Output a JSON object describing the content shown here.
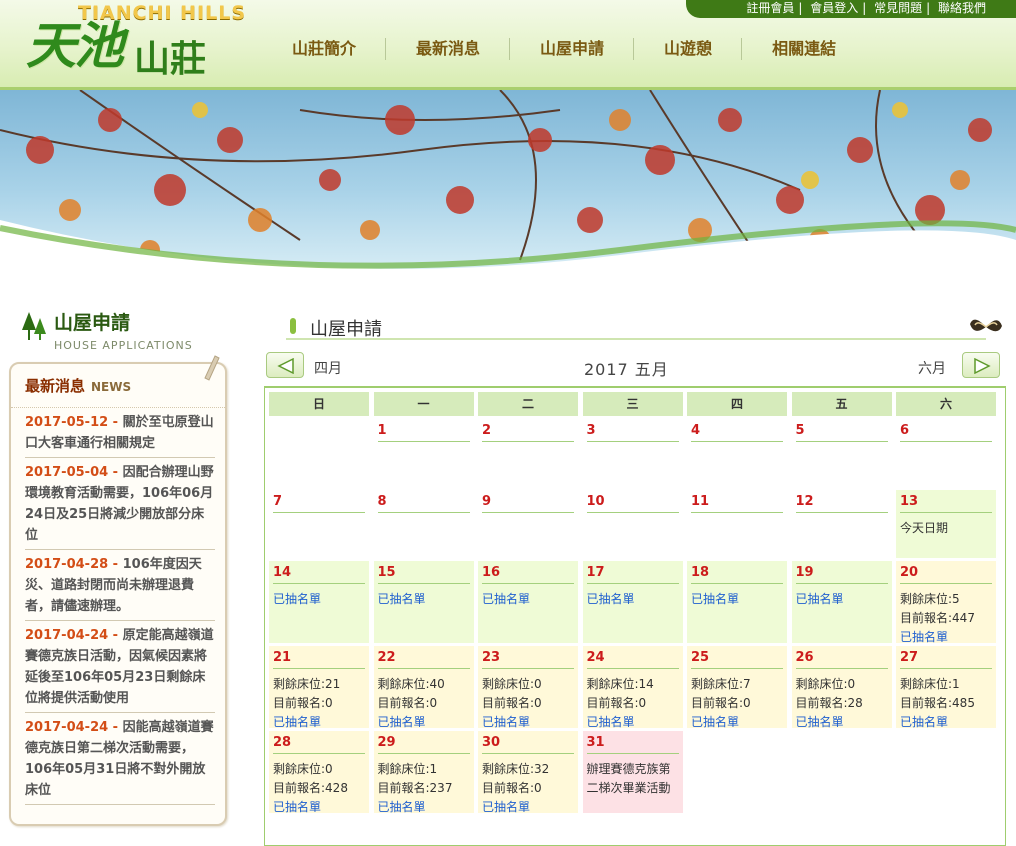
{
  "site": {
    "logo_en": "TIANCHI HILLS",
    "logo_zh_big": "天池",
    "logo_zh_small": "山莊"
  },
  "toplinks": [
    "註冊會員",
    "會員登入",
    "常見問題",
    "聯絡我們"
  ],
  "nav": [
    "山莊簡介",
    "最新消息",
    "山屋申請",
    "山遊憩",
    "相關連結"
  ],
  "sidebar": {
    "title_zh": "山屋申請",
    "title_en": "HOUSE APPLICATIONS",
    "news_title": "最新消息",
    "news_title_en": "NEWS",
    "news": [
      {
        "date": "2017-05-12",
        "text": "關於至屯原登山口大客車通行相關規定"
      },
      {
        "date": "2017-05-04",
        "text": "因配合辦理山野環境教育活動需要，106年06月24日及25日將減少開放部分床位"
      },
      {
        "date": "2017-04-28",
        "text": "106年度因天災、道路封閉而尚未辦理退費者，請儘速辦理。"
      },
      {
        "date": "2017-04-24",
        "text": "原定能高越嶺道賽德克族日活動，因氣候因素將延後至106年05月23日剩餘床位將提供活動使用"
      },
      {
        "date": "2017-04-24",
        "text": "因能高越嶺道賽德克族日第二梯次活動需要，106年05月31日將不對外開放床位"
      }
    ]
  },
  "main": {
    "section_title": "山屋申請",
    "prev_month": "四月",
    "current_month": "2017 五月",
    "next_month": "六月",
    "weekdays": [
      "日",
      "一",
      "二",
      "三",
      "四",
      "五",
      "六"
    ],
    "weeks": [
      [
        {
          "day": "",
          "style": "empty"
        },
        {
          "day": "1",
          "style": "plain"
        },
        {
          "day": "2",
          "style": "plain"
        },
        {
          "day": "3",
          "style": "plain"
        },
        {
          "day": "4",
          "style": "plain"
        },
        {
          "day": "5",
          "style": "plain"
        },
        {
          "day": "6",
          "style": "plain"
        }
      ],
      [
        {
          "day": "7",
          "style": "plain"
        },
        {
          "day": "8",
          "style": "plain"
        },
        {
          "day": "9",
          "style": "plain"
        },
        {
          "day": "10",
          "style": "plain"
        },
        {
          "day": "11",
          "style": "plain"
        },
        {
          "day": "12",
          "style": "plain"
        },
        {
          "day": "13",
          "style": "hl",
          "note": "今天日期"
        }
      ],
      [
        {
          "day": "14",
          "style": "hl",
          "link": "已抽名單"
        },
        {
          "day": "15",
          "style": "hl",
          "link": "已抽名單"
        },
        {
          "day": "16",
          "style": "hl",
          "link": "已抽名單"
        },
        {
          "day": "17",
          "style": "hl",
          "link": "已抽名單"
        },
        {
          "day": "18",
          "style": "hl",
          "link": "已抽名單"
        },
        {
          "day": "19",
          "style": "hl",
          "link": "已抽名單"
        },
        {
          "day": "20",
          "style": "fill",
          "remain": "剩餘床位:5",
          "signup": "目前報名:447",
          "link": "已抽名單"
        }
      ],
      [
        {
          "day": "21",
          "style": "fill",
          "remain": "剩餘床位:21",
          "signup": "目前報名:0",
          "link": "已抽名單"
        },
        {
          "day": "22",
          "style": "fill",
          "remain": "剩餘床位:40",
          "signup": "目前報名:0",
          "link": "已抽名單"
        },
        {
          "day": "23",
          "style": "fill",
          "remain": "剩餘床位:0",
          "signup": "目前報名:0",
          "link": "已抽名單"
        },
        {
          "day": "24",
          "style": "fill",
          "remain": "剩餘床位:14",
          "signup": "目前報名:0",
          "link": "已抽名單"
        },
        {
          "day": "25",
          "style": "fill",
          "remain": "剩餘床位:7",
          "signup": "目前報名:0",
          "link": "已抽名單"
        },
        {
          "day": "26",
          "style": "fill",
          "remain": "剩餘床位:0",
          "signup": "目前報名:28",
          "link": "已抽名單"
        },
        {
          "day": "27",
          "style": "fill",
          "remain": "剩餘床位:1",
          "signup": "目前報名:485",
          "link": "已抽名單"
        }
      ],
      [
        {
          "day": "28",
          "style": "fill",
          "remain": "剩餘床位:0",
          "signup": "目前報名:428",
          "link": "已抽名單"
        },
        {
          "day": "29",
          "style": "fill",
          "remain": "剩餘床位:1",
          "signup": "目前報名:237",
          "link": "已抽名單"
        },
        {
          "day": "30",
          "style": "fill",
          "remain": "剩餘床位:32",
          "signup": "目前報名:0",
          "link": "已抽名單"
        },
        {
          "day": "31",
          "style": "pink",
          "note": "辦理賽德克族第二梯次畢業活動"
        },
        {
          "day": "",
          "style": "empty"
        },
        {
          "day": "",
          "style": "empty"
        },
        {
          "day": "",
          "style": "empty"
        }
      ]
    ]
  },
  "colors": {
    "brand_green": "#3f7a16",
    "date_red": "#cc1c1c",
    "link_blue": "#1f5fcf",
    "news_date": "#d34d16"
  }
}
